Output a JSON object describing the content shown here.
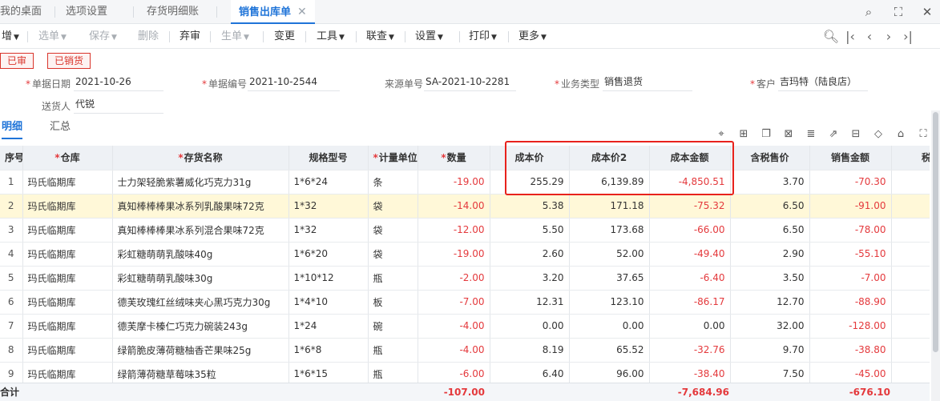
{
  "tabs": [
    {
      "label": "我的桌面"
    },
    {
      "label": "选项设置"
    },
    {
      "label": "存货明细账"
    },
    {
      "label": "销售出库单"
    }
  ],
  "tab_close_glyph": "✕",
  "toolbar": {
    "add": "增",
    "select": "选单",
    "save": "保存",
    "delete": "删除",
    "abandon": "弃审",
    "generate": "生单",
    "change": "变更",
    "tools": "工具",
    "link": "联查",
    "settings": "设置",
    "print": "打印",
    "more": "更多"
  },
  "status": {
    "audited": "已审",
    "sold": "已销货"
  },
  "form": {
    "doc_date_label": "单据日期",
    "doc_date": "2021-10-26",
    "doc_no_label": "单据编号",
    "doc_no": "2021-10-2544",
    "source_no_label": "来源单号",
    "source_no": "SA-2021-10-2281",
    "biz_type_label": "业务类型",
    "biz_type": "销售退货",
    "customer_label": "客户",
    "customer": "吉玛特（陆良店）",
    "deliverer_label": "送货人",
    "deliverer": "代锐"
  },
  "subtabs": {
    "detail": "明细",
    "summary": "汇总"
  },
  "table": {
    "headers": {
      "idx": "序号",
      "warehouse": "仓库",
      "name": "存货名称",
      "spec": "规格型号",
      "unit": "计量单位",
      "qty": "数量",
      "cost": "成本价",
      "cost2": "成本价2",
      "cost_amt": "成本金额",
      "tax_price": "含税售价",
      "sale_amt": "销售金额",
      "tax": "税额"
    },
    "rows": [
      {
        "idx": "1",
        "warehouse": "玛氏临期库",
        "name": "士力架轻脆紫薯威化巧克力31g",
        "spec": "1*6*24",
        "unit": "条",
        "qty": "-19.00",
        "cost": "255.29",
        "cost2": "6,139.89",
        "cost_amt": "-4,850.51",
        "tax_price": "3.70",
        "sale_amt": "-70.30"
      },
      {
        "idx": "2",
        "warehouse": "玛氏临期库",
        "name": "真知棒棒棒果冰系列乳酸果味72克",
        "spec": "1*32",
        "unit": "袋",
        "qty": "-14.00",
        "cost": "5.38",
        "cost2": "171.18",
        "cost_amt": "-75.32",
        "tax_price": "6.50",
        "sale_amt": "-91.00"
      },
      {
        "idx": "3",
        "warehouse": "玛氏临期库",
        "name": "真知棒棒棒果冰系列混合果味72克",
        "spec": "1*32",
        "unit": "袋",
        "qty": "-12.00",
        "cost": "5.50",
        "cost2": "173.68",
        "cost_amt": "-66.00",
        "tax_price": "6.50",
        "sale_amt": "-78.00"
      },
      {
        "idx": "4",
        "warehouse": "玛氏临期库",
        "name": "彩虹糖萌萌乳酸味40g",
        "spec": "1*6*20",
        "unit": "袋",
        "qty": "-19.00",
        "cost": "2.60",
        "cost2": "52.00",
        "cost_amt": "-49.40",
        "tax_price": "2.90",
        "sale_amt": "-55.10"
      },
      {
        "idx": "5",
        "warehouse": "玛氏临期库",
        "name": "彩虹糖萌萌乳酸味30g",
        "spec": "1*10*12",
        "unit": "瓶",
        "qty": "-2.00",
        "cost": "3.20",
        "cost2": "37.65",
        "cost_amt": "-6.40",
        "tax_price": "3.50",
        "sale_amt": "-7.00"
      },
      {
        "idx": "6",
        "warehouse": "玛氏临期库",
        "name": "德芙玫瑰红丝绒味夹心黑巧克力30g",
        "spec": "1*4*10",
        "unit": "板",
        "qty": "-7.00",
        "cost": "12.31",
        "cost2": "123.10",
        "cost_amt": "-86.17",
        "tax_price": "12.70",
        "sale_amt": "-88.90"
      },
      {
        "idx": "7",
        "warehouse": "玛氏临期库",
        "name": "德芙摩卡榛仁巧克力碗装243g",
        "spec": "1*24",
        "unit": "碗",
        "qty": "-4.00",
        "cost": "0.00",
        "cost2": "0.00",
        "cost_amt": "0.00",
        "tax_price": "32.00",
        "sale_amt": "-128.00"
      },
      {
        "idx": "8",
        "warehouse": "玛氏临期库",
        "name": "绿箭脆皮薄荷糖柚香芒果味25g",
        "spec": "1*6*8",
        "unit": "瓶",
        "qty": "-4.00",
        "cost": "8.19",
        "cost2": "65.52",
        "cost_amt": "-32.76",
        "tax_price": "9.70",
        "sale_amt": "-38.80"
      },
      {
        "idx": "9",
        "warehouse": "玛氏临期库",
        "name": "绿箭薄荷糖草莓味35粒",
        "spec": "1*6*15",
        "unit": "瓶",
        "qty": "-6.00",
        "cost": "6.40",
        "cost2": "96.00",
        "cost_amt": "-38.40",
        "tax_price": "7.50",
        "sale_amt": "-45.00"
      }
    ]
  },
  "footer": {
    "label": "合计",
    "qty_total": "-107.00",
    "cost_amt_total": "-7,684.96",
    "sale_amt_total": "-676.10"
  },
  "colors": {
    "accent": "#1f74d8",
    "negative": "#e4393c",
    "highlight_box": "#e8221c",
    "selected_row": "#fff8d8"
  }
}
